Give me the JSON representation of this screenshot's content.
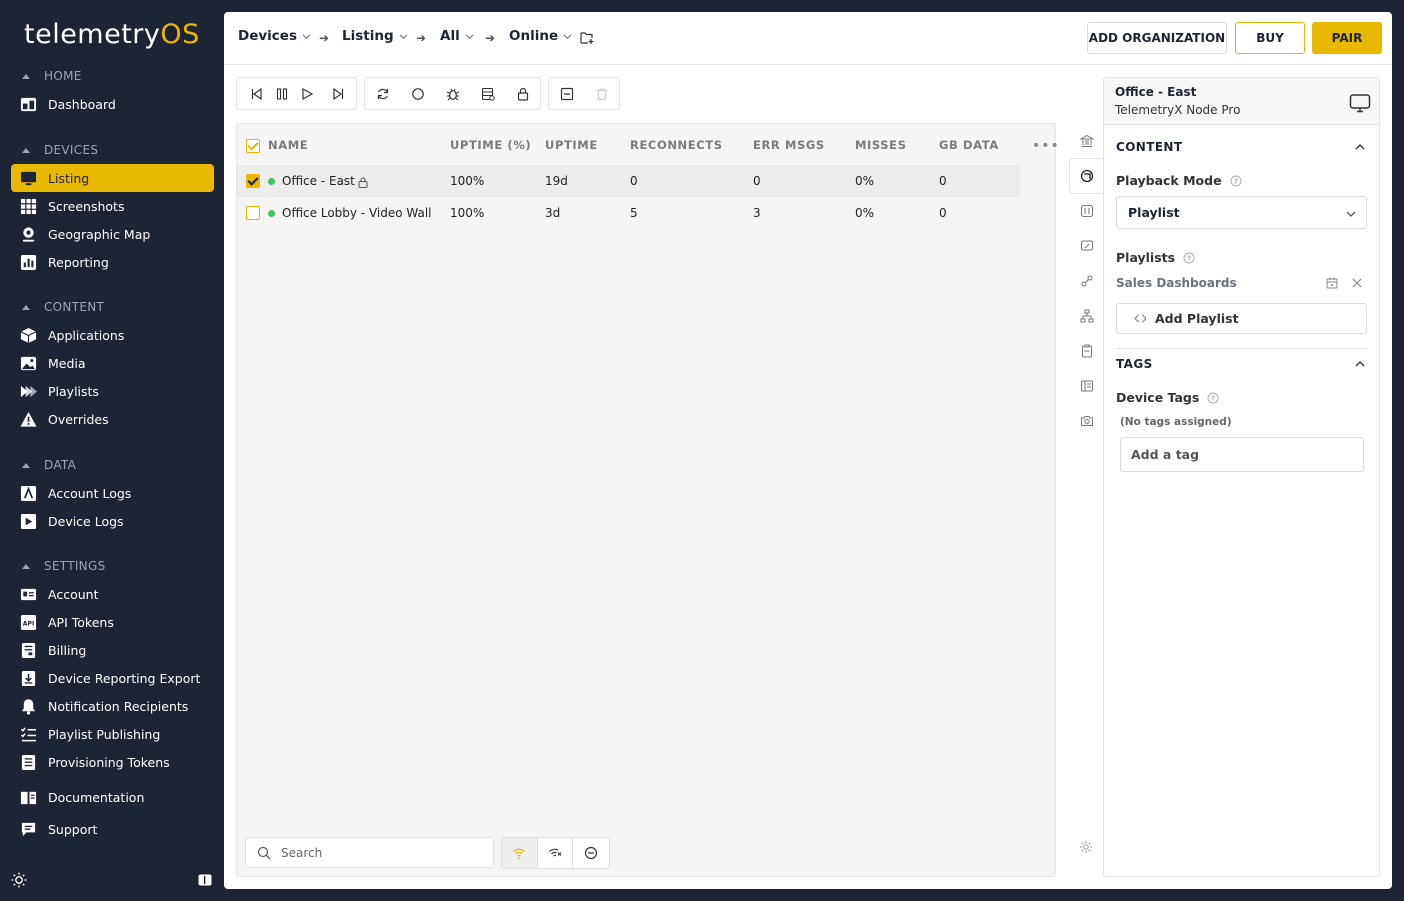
{
  "brand": {
    "part1": "telemetry",
    "part2": "OS",
    "accent": "#e9b800"
  },
  "sidebar": {
    "sections": [
      {
        "title": "HOME",
        "items": [
          {
            "label": "Dashboard",
            "icon": "dashboard-icon"
          }
        ]
      },
      {
        "title": "DEVICES",
        "items": [
          {
            "label": "Listing",
            "icon": "monitor-icon",
            "active": true
          },
          {
            "label": "Screenshots",
            "icon": "grid-icon"
          },
          {
            "label": "Geographic Map",
            "icon": "map-pin-icon"
          },
          {
            "label": "Reporting",
            "icon": "bar-chart-icon"
          }
        ]
      },
      {
        "title": "CONTENT",
        "items": [
          {
            "label": "Applications",
            "icon": "cube-icon"
          },
          {
            "label": "Media",
            "icon": "image-icon"
          },
          {
            "label": "Playlists",
            "icon": "playlist-icon"
          },
          {
            "label": "Overrides",
            "icon": "warning-icon"
          }
        ]
      },
      {
        "title": "DATA",
        "items": [
          {
            "label": "Account Logs",
            "icon": "account-log-icon"
          },
          {
            "label": "Device Logs",
            "icon": "device-log-icon"
          }
        ]
      },
      {
        "title": "SETTINGS",
        "items": [
          {
            "label": "Account",
            "icon": "id-card-icon"
          },
          {
            "label": "API Tokens",
            "icon": "api-icon"
          },
          {
            "label": "Billing",
            "icon": "billing-icon"
          },
          {
            "label": "Device Reporting Export",
            "icon": "download-icon"
          },
          {
            "label": "Notification Recipients",
            "icon": "bell-icon"
          },
          {
            "label": "Playlist Publishing",
            "icon": "checklist-icon"
          },
          {
            "label": "Provisioning Tokens",
            "icon": "token-icon"
          }
        ]
      }
    ],
    "footer_items": [
      {
        "label": "Documentation",
        "icon": "book-icon"
      },
      {
        "label": "Support",
        "icon": "chat-icon"
      }
    ]
  },
  "breadcrumb": [
    "Devices",
    "Listing",
    "All",
    "Online"
  ],
  "header_buttons": {
    "add_org": "ADD ORGANIZATION",
    "buy": "BUY",
    "pair": "PAIR"
  },
  "table": {
    "columns": [
      "NAME",
      "UPTIME (%)",
      "UPTIME",
      "RECONNECTS",
      "ERR MSGS",
      "MISSES",
      "GB DATA"
    ],
    "rows": [
      {
        "name": "Office - East",
        "uptime_pct": "100%",
        "uptime": "19d",
        "reconnects": "0",
        "err_msgs": "0",
        "misses": "0%",
        "gb_data": "0",
        "selected": true,
        "locked": true,
        "status": "online"
      },
      {
        "name": "Office Lobby - Video Wall",
        "uptime_pct": "100%",
        "uptime": "3d",
        "reconnects": "5",
        "err_msgs": "3",
        "misses": "0%",
        "gb_data": "0",
        "selected": false,
        "locked": false,
        "status": "online"
      }
    ],
    "more_label": "•••"
  },
  "search": {
    "placeholder": "Search",
    "value": ""
  },
  "details": {
    "title": "Office - East",
    "subtitle": "TelemetryX Node Pro",
    "content_section": "CONTENT",
    "playback_mode_label": "Playback Mode",
    "playback_mode_value": "Playlist",
    "playlists_label": "Playlists",
    "playlist_item": "Sales Dashboards",
    "add_playlist": "Add Playlist",
    "tags_section": "TAGS",
    "device_tags_label": "Device Tags",
    "no_tags": "(No tags assigned)",
    "add_tag_placeholder": "Add a tag"
  },
  "colors": {
    "sidebar_bg": "#1d2433",
    "accent": "#e9b800",
    "online": "#42c45c"
  }
}
